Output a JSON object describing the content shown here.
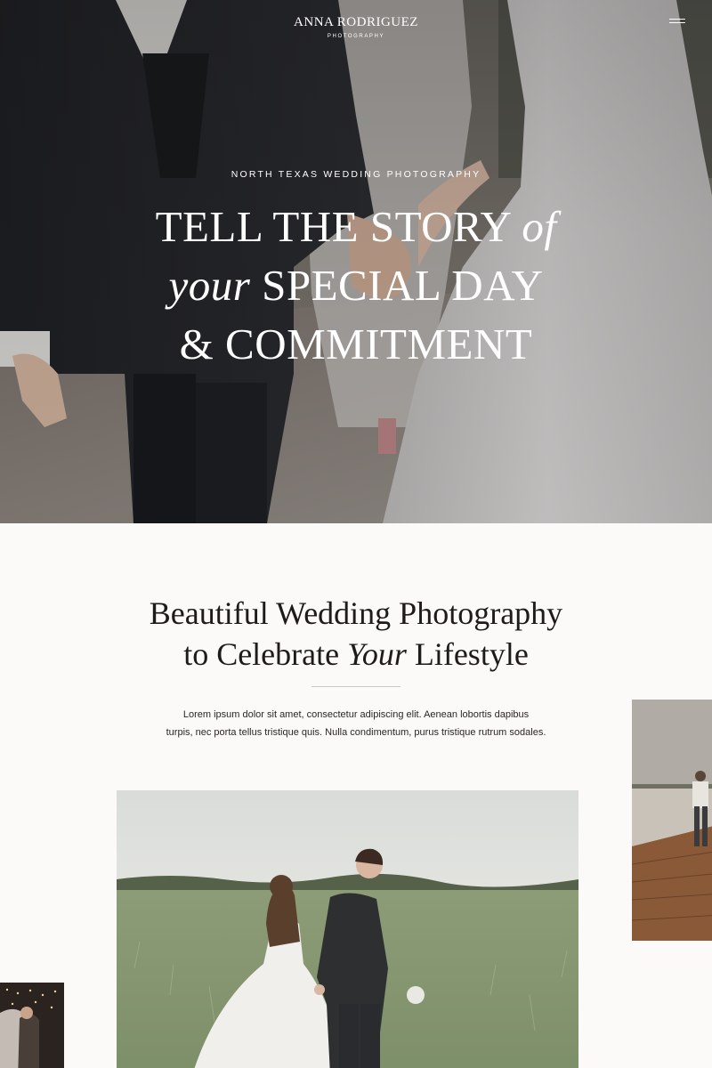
{
  "header": {
    "brand_name": "ANNA RODRIGUEZ",
    "brand_sub": "PHOTOGRAPHY",
    "menu_icon": "hamburger-menu-icon"
  },
  "hero": {
    "eyebrow": "NORTH TEXAS WEDDING PHOTOGRAPHY",
    "heading": {
      "line1_main": "TELL THE STORY ",
      "line1_italic": "of",
      "line2_italic": "your",
      "line2_main": " SPECIAL DAY",
      "line3": "& COMMITMENT"
    }
  },
  "intro": {
    "heading": {
      "line1": "Beautiful Wedding Photography",
      "line2_start": "to Celebrate ",
      "line2_italic": "Your",
      "line2_end": " Lifestyle"
    },
    "body_line1": "Lorem ipsum dolor sit amet, consectetur adipiscing elit. Aenean lobortis dapibus",
    "body_line2": "turpis, nec porta tellus tristique quis. Nulla condimentum, purus tristique rutrum sodales."
  },
  "colors": {
    "page_background": "#fbfaf8",
    "heading_text": "#1f1b1a",
    "hero_text": "#ffffff",
    "divider": "#cfc8c2"
  }
}
